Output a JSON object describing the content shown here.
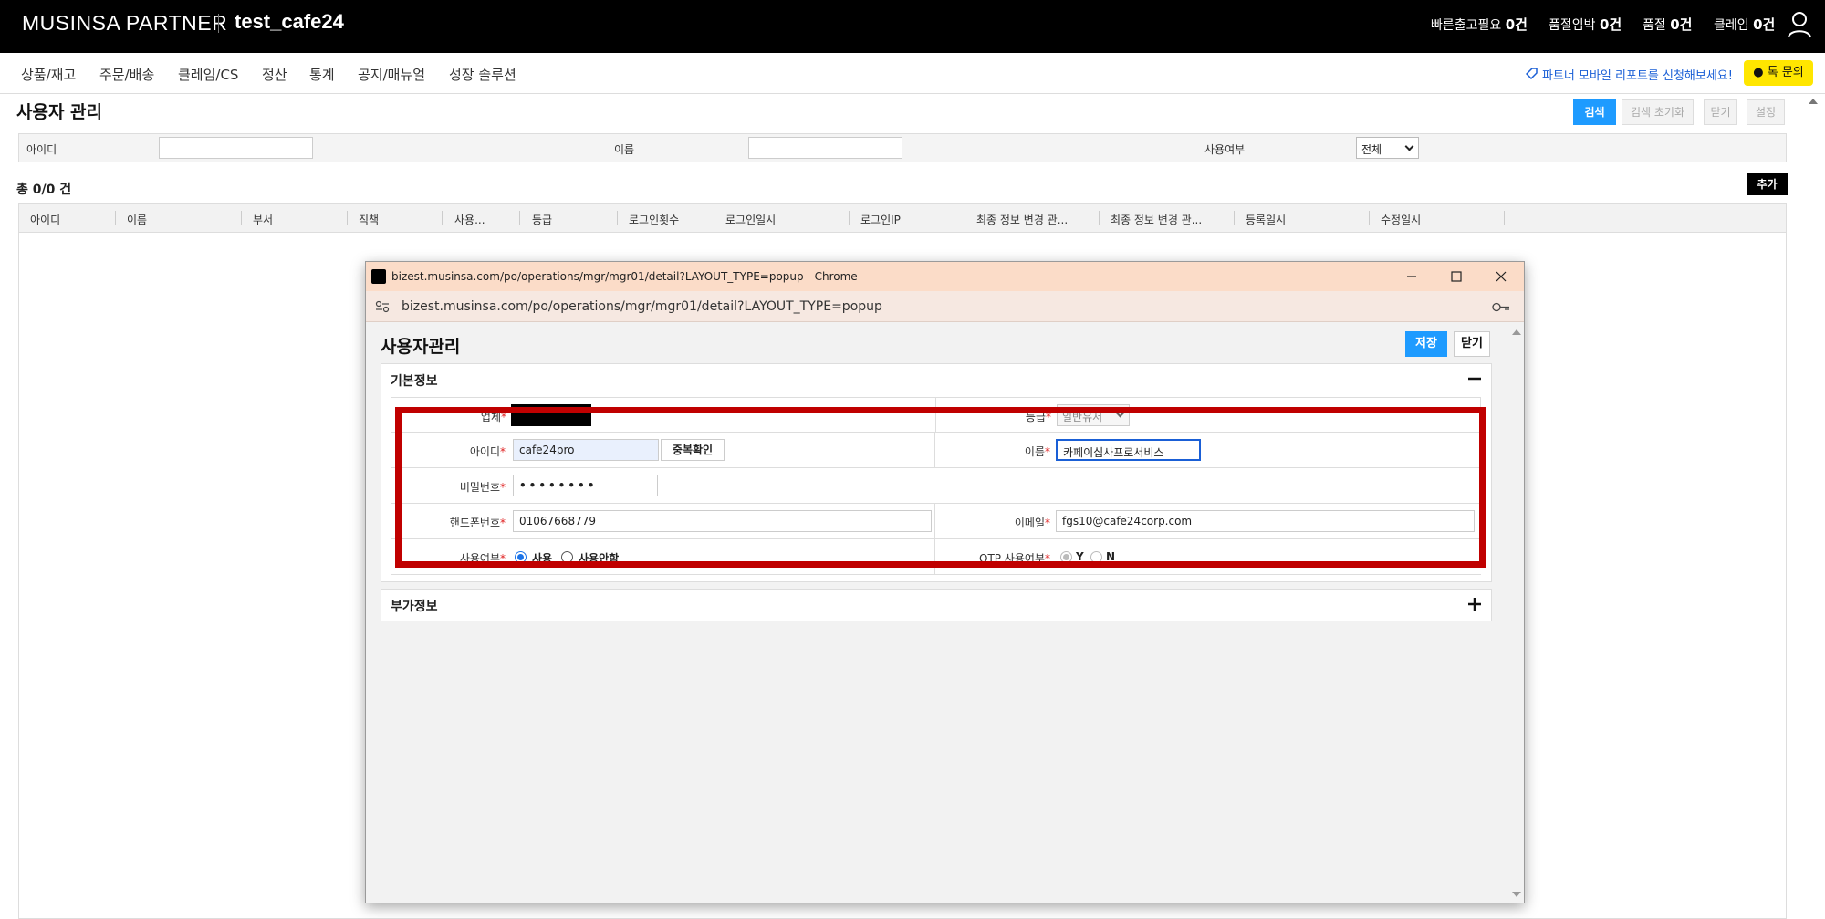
{
  "header": {
    "brand": "MUSINSA PARTNER",
    "store": "test_cafe24",
    "status": [
      {
        "label": "빠른출고필요",
        "count": "0건"
      },
      {
        "label": "품절임박",
        "count": "0건"
      },
      {
        "label": "품절",
        "count": "0건"
      },
      {
        "label": "클레임",
        "count": "0건"
      }
    ]
  },
  "nav": {
    "items": [
      "상품/재고",
      "주문/배송",
      "클레임/CS",
      "정산",
      "통계",
      "공지/매뉴얼",
      "성장 솔루션"
    ],
    "mobile_report": "파트너 모바일 리포트를 신청해보세요!",
    "talk_inquiry": "톡 문의"
  },
  "page": {
    "title": "사용자 관리",
    "buttons": {
      "search": "검색",
      "reset": "검색 초기화",
      "close": "닫기",
      "settings": "설정"
    },
    "filters": {
      "id_label": "아이디",
      "name_label": "이름",
      "use_label": "사용여부",
      "use_value": "전체"
    },
    "total": "총 0/0 건",
    "add_button": "추가",
    "columns": [
      "아이디",
      "이름",
      "부서",
      "직책",
      "사용...",
      "등급",
      "로그인횟수",
      "로그인일시",
      "로그인IP",
      "최종 정보 변경 관...",
      "최종 정보 변경 관...",
      "등록일시",
      "수정일시"
    ]
  },
  "popup": {
    "window_title": "bizest.musinsa.com/po/operations/mgr/mgr01/detail?LAYOUT_TYPE=popup - Chrome",
    "url": "bizest.musinsa.com/po/operations/mgr/mgr01/detail?LAYOUT_TYPE=popup",
    "heading": "사용자관리",
    "save_button": "저장",
    "close_button": "닫기",
    "basic_section": "기본정보",
    "extra_section": "부가정보",
    "req_mark": "*",
    "fields": {
      "company_label": "업체",
      "grade_label": "등급",
      "grade_value": "일반유저",
      "id_label": "아이디",
      "id_value": "cafe24pro",
      "dup_check": "중복확인",
      "name_label": "이름",
      "name_value": "카페이십사프로서비스",
      "password_label": "비밀번호",
      "password_value": "••••••••",
      "phone_label": "핸드폰번호",
      "phone_value": "01067668779",
      "email_label": "이메일",
      "email_value": "fgs10@cafe24corp.com",
      "use_label": "사용여부",
      "use_yes": "사용",
      "use_no": "사용안함",
      "otp_label": "OTP 사용여부",
      "otp_yes": "Y",
      "otp_no": "N"
    }
  },
  "colors": {
    "accent_blue": "#1e9bff",
    "highlight_red": "#c00000",
    "talk_yellow": "#ffe600",
    "popup_titlebar": "#fbdcc8"
  }
}
